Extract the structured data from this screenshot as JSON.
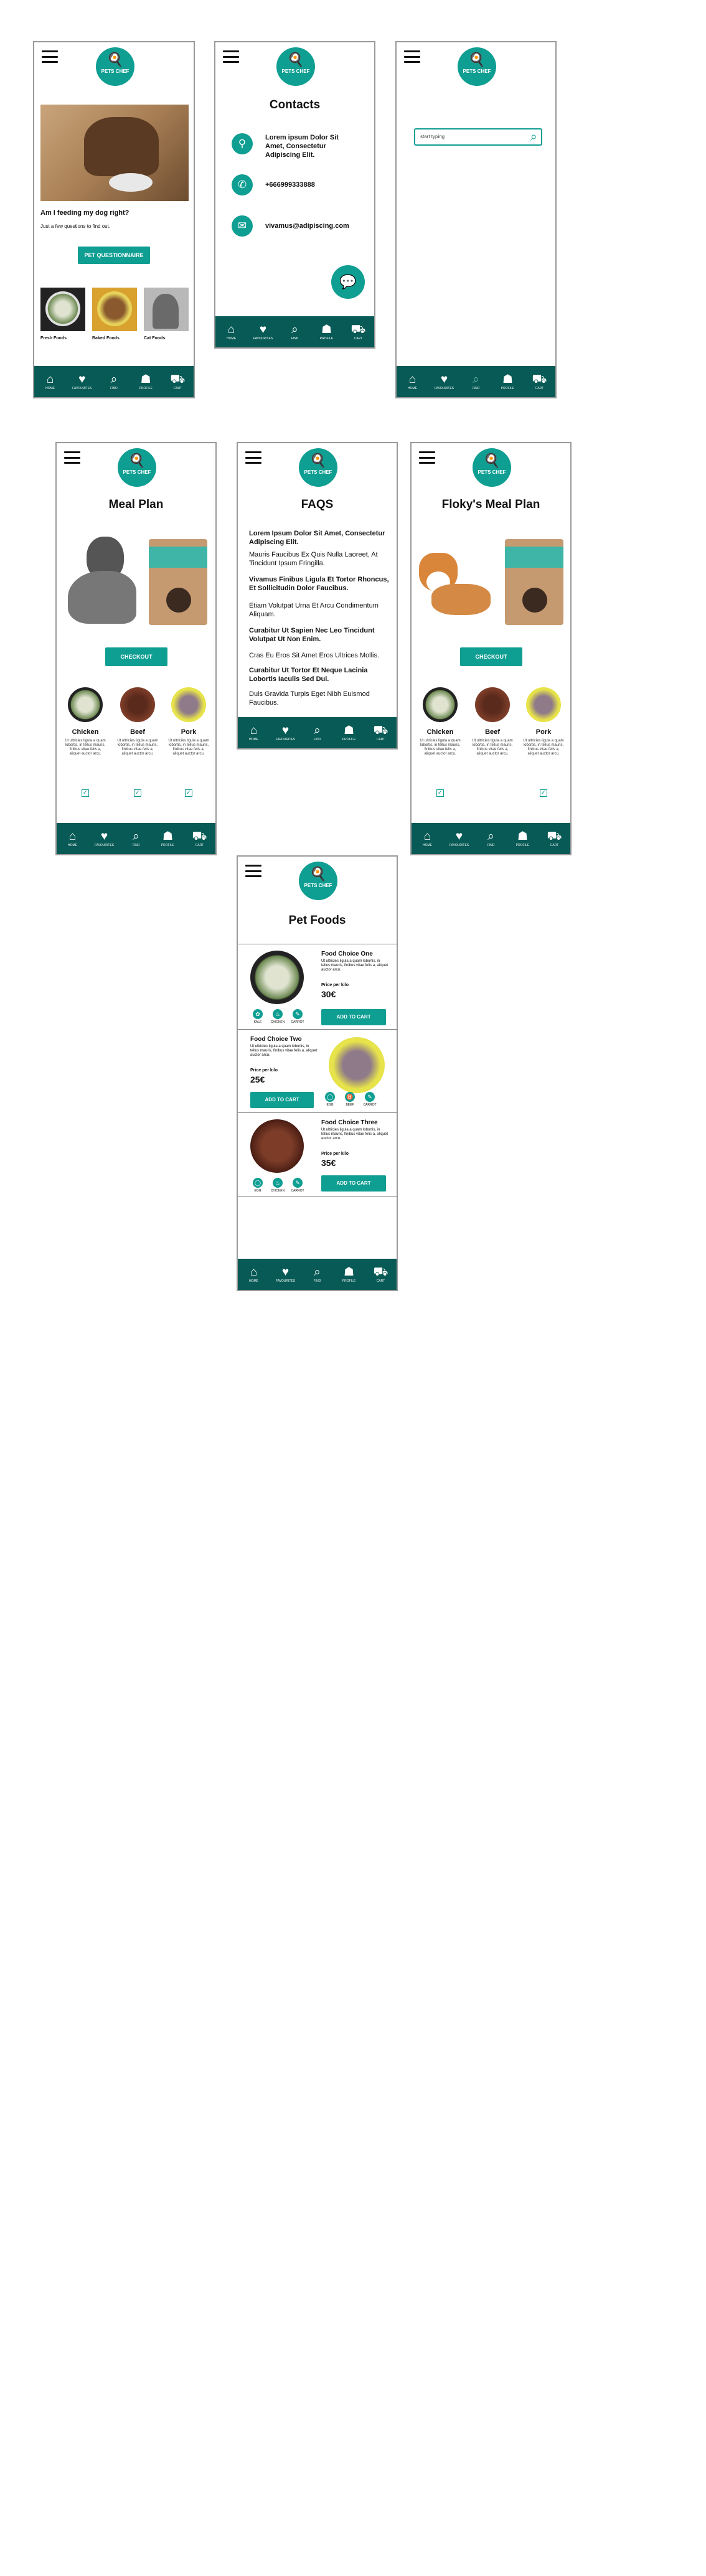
{
  "brand": {
    "logo_text": "PETS CHEF",
    "accent": "#0f9e92",
    "nav_bg": "#075a55"
  },
  "nav": [
    {
      "label": "HOME",
      "icon": "home-icon",
      "glyph": "⌂"
    },
    {
      "label": "FAVOURITES",
      "icon": "heart-icon",
      "glyph": "♥"
    },
    {
      "label": "FIND",
      "icon": "search-icon",
      "glyph": "⌕"
    },
    {
      "label": "PROFILE",
      "icon": "profile-icon",
      "glyph": "☗"
    },
    {
      "label": "CART",
      "icon": "cart-icon",
      "glyph": "⛟"
    }
  ],
  "home": {
    "heading": "Am I feeding my dog right?",
    "sub": "Just a few questions to find out.",
    "button": "PET QUESTIONNAIRE",
    "categories": [
      {
        "label": "Fresh Foods"
      },
      {
        "label": "Baked Foods"
      },
      {
        "label": "Cat Foods"
      }
    ]
  },
  "contacts": {
    "title": "Contacts",
    "address": "Lorem ipsum Dolor Sit Amet, Consectetur Adipiscing Elit.",
    "phone": "+666999333888",
    "email": "vivamus@adipiscing.com"
  },
  "search": {
    "value": "start typing"
  },
  "meal_plan": {
    "title": "Meal Plan",
    "button": "CHECKOUT",
    "items": [
      {
        "name": "Chicken",
        "desc": "Ut ultricies ligula a quam lobortis, in tellus mauris, finibus vitae felis a, aliquet auctor arcu."
      },
      {
        "name": "Beef",
        "desc": "Ut ultricies ligula a quam lobortis, in tellus mauris, finibus vitae felis a, aliquet auctor arcu."
      },
      {
        "name": "Pork",
        "desc": "Ut ultricies ligula a quam lobortis, in tellus mauris, finibus vitae felis a, aliquet auctor arcu."
      }
    ]
  },
  "faqs": {
    "title": "FAQS",
    "entries": [
      {
        "q": "Lorem Ipsum Dolor Sit Amet, Consectetur Adipiscing Elit.",
        "a": "Mauris Faucibus Ex Quis Nulla Laoreet, At Tincidunt Ipsum Fringilla."
      },
      {
        "q": "Vivamus Finibus Ligula Et Tortor Rhoncus, Et Sollicitudin Dolor Faucibus.",
        "a": "Etiam Volutpat Urna Et Arcu Condimentum Aliquam."
      },
      {
        "q": "Curabitur Ut Sapien Nec Leo Tincidunt Volutpat Ut Non Enim.",
        "a": "Cras Eu Eros Sit Amet Eros Ultrices Mollis."
      },
      {
        "q": "Curabitur Ut Tortor Et Neque Lacinia Lobortis Iaculis Sed Dui.",
        "a": "Duis Gravida Turpis Eget Nibh Euismod Faucibus."
      }
    ]
  },
  "floky": {
    "title": "Floky's Meal Plan",
    "button": "CHECKOUT"
  },
  "pet_foods": {
    "title": "Pet Foods",
    "price_label": "Price per kilo",
    "button": "ADD TO CART",
    "desc": "Ut ultricies ligula a quam lobortis, in tellus mauris, finibus vitae felis a, aliquet auctor arcu.",
    "items": [
      {
        "name": "Food Choice One",
        "price": "30€",
        "ingredients": [
          "KALE",
          "CHICKEN",
          "CARROT"
        ]
      },
      {
        "name": "Food Choice Two",
        "price": "25€",
        "ingredients": [
          "EGG",
          "BEEF",
          "CARROT"
        ]
      },
      {
        "name": "Food Choice Three",
        "price": "35€",
        "ingredients": [
          "EGG",
          "CHICKEN",
          "CARROT"
        ]
      }
    ]
  }
}
